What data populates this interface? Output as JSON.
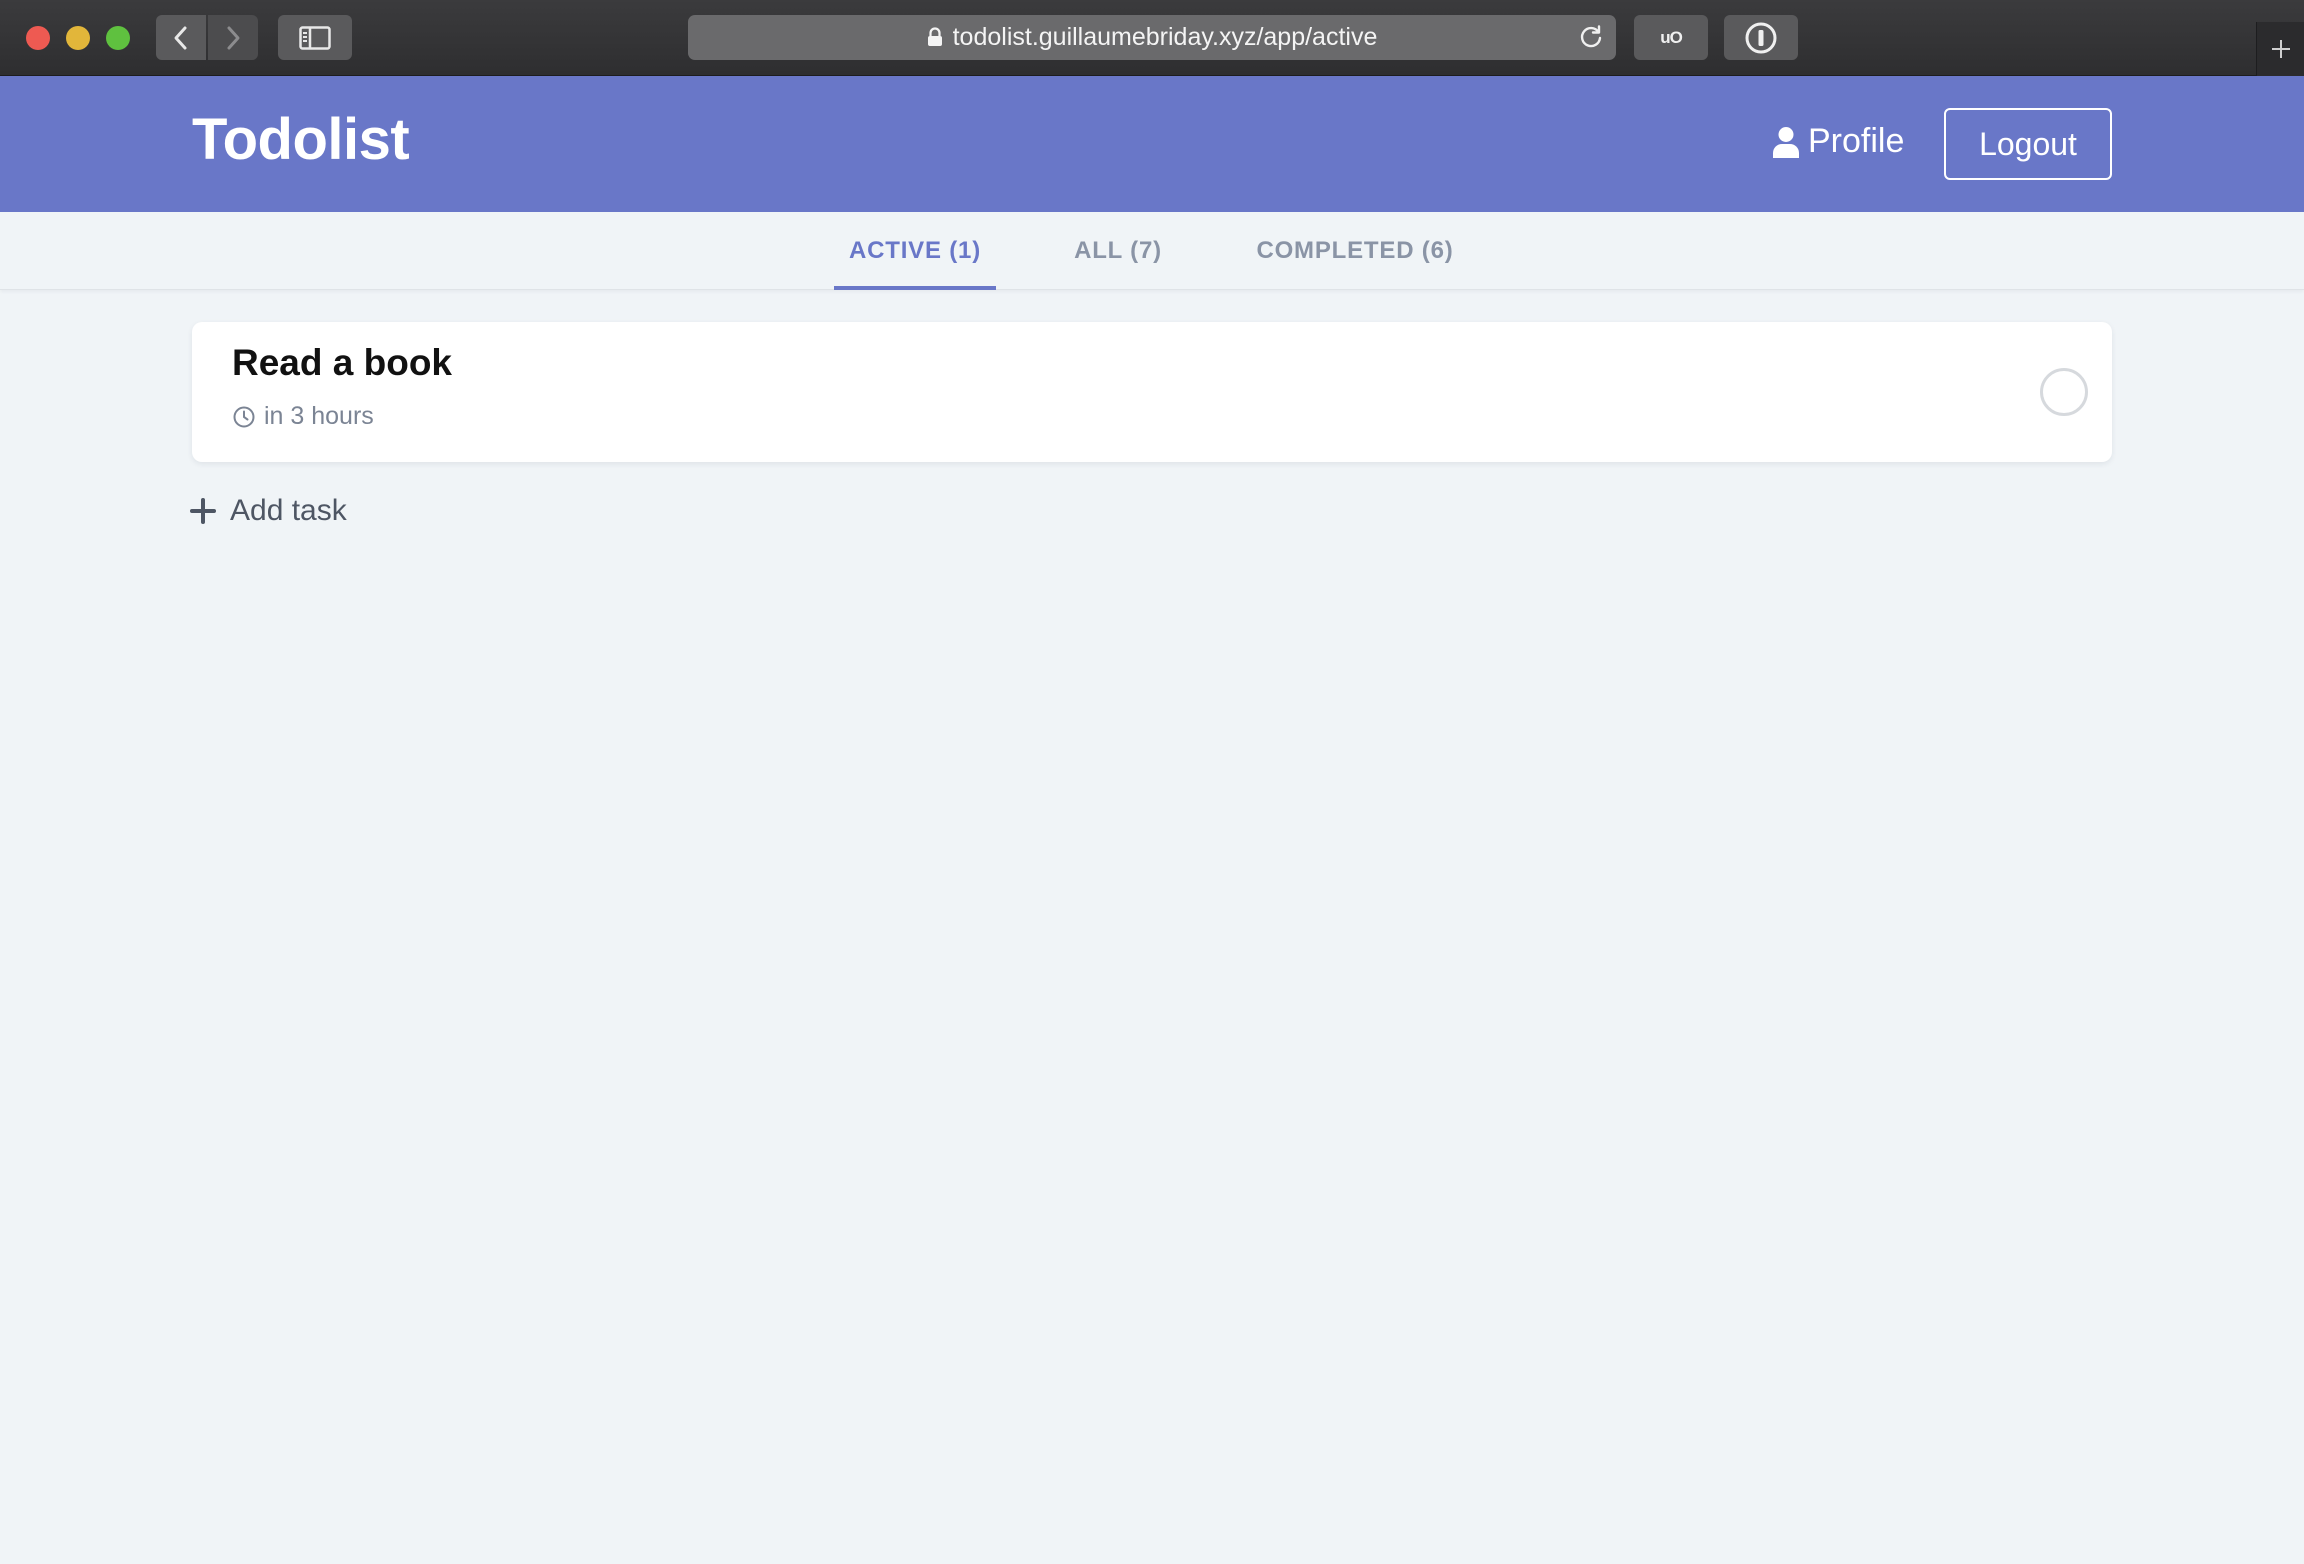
{
  "browser": {
    "url": "todolist.guillaumebriday.xyz/app/active",
    "ext1_label": "uO"
  },
  "header": {
    "brand": "Todolist",
    "profile_label": "Profile",
    "logout_label": "Logout",
    "accent_color": "#6977c8"
  },
  "tabs": [
    {
      "label": "ACTIVE (1)",
      "active": true
    },
    {
      "label": "ALL (7)",
      "active": false
    },
    {
      "label": "COMPLETED (6)",
      "active": false
    }
  ],
  "tasks": [
    {
      "title": "Read a book",
      "due": "in 3 hours",
      "completed": false
    }
  ],
  "add_task_label": "Add task",
  "icons": {
    "back": "chevron-left-icon",
    "forward": "chevron-right-icon",
    "sidebar": "sidebar-icon",
    "lock": "lock-icon",
    "reload": "reload-icon",
    "password": "password-manager-icon",
    "new_tab": "plus-icon",
    "profile": "user-icon",
    "clock": "clock-icon",
    "add": "plus-icon"
  }
}
